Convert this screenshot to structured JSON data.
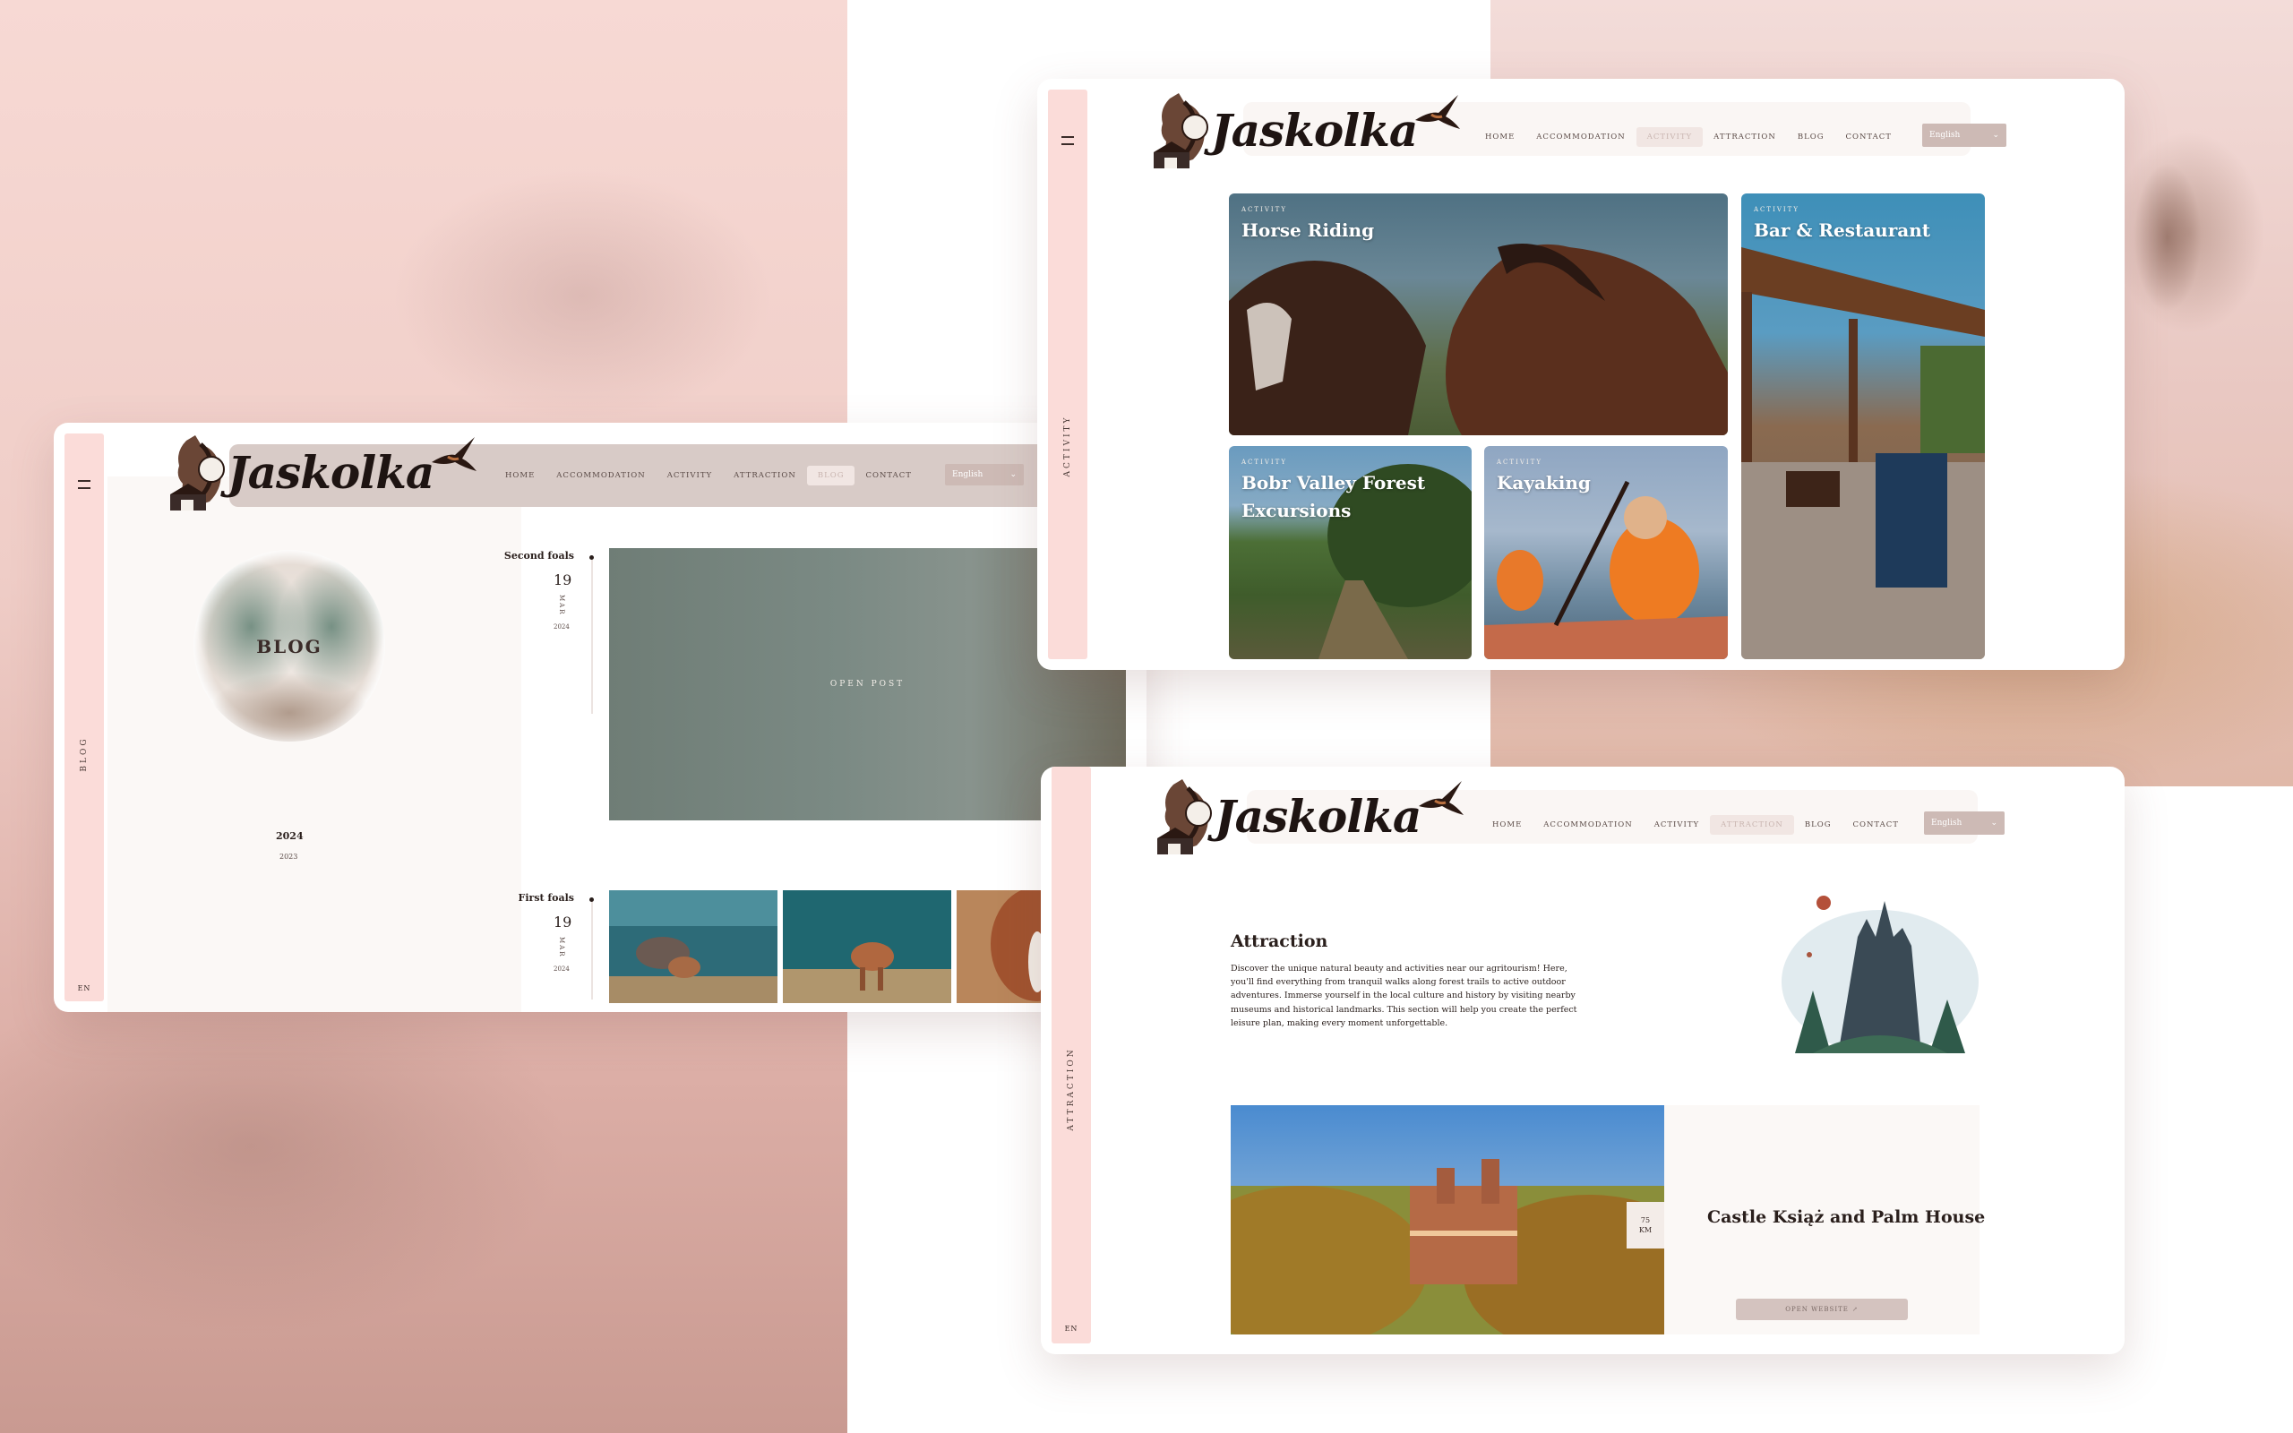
{
  "brand": {
    "logo_text": "Jaskolka"
  },
  "nav": [
    "HOME",
    "ACCOMMODATION",
    "ACTIVITY",
    "ATTRACTION",
    "BLOG",
    "CONTACT"
  ],
  "language": {
    "selected": "English",
    "short": "EN"
  },
  "blog_page": {
    "rail_label": "BLOG",
    "active_nav": "BLOG",
    "hero_title": "BLOG",
    "years": [
      "2024",
      "2023"
    ],
    "posts": [
      {
        "title": "Second foals",
        "day": "19",
        "month": "MAR",
        "year": "2024",
        "cta": "OPEN POST"
      },
      {
        "title": "First foals",
        "day": "19",
        "month": "MAR",
        "year": "2024"
      }
    ]
  },
  "activity_page": {
    "rail_label": "ACTIVITY",
    "active_nav": "ACTIVITY",
    "tiles": [
      {
        "tag": "ACTIVITY",
        "name": "Horse Riding"
      },
      {
        "tag": "ACTIVITY",
        "name": "Bar & Restaurant"
      },
      {
        "tag": "ACTIVITY",
        "name": "Bobr Valley Forest Excursions"
      },
      {
        "tag": "ACTIVITY",
        "name": "Kayaking"
      }
    ]
  },
  "attraction_page": {
    "rail_label": "ATTRACTION",
    "active_nav": "ATTRACTION",
    "title": "Attraction",
    "description": "Discover the unique natural beauty and activities near our agritourism! Here, you'll find everything from tranquil walks along forest trails to active outdoor adventures. Immerse yourself in the local culture and history by visiting nearby museums and historical landmarks. This section will help you create the perfect leisure plan, making every moment unforgettable.",
    "item": {
      "name": "Castle Książ and Palm House",
      "distance_value": "75",
      "distance_unit": "KM",
      "cta": "OPEN WEBSITE"
    }
  },
  "colors": {
    "accent_pink": "#fbdcd9",
    "header_tan": "#d8cbc7",
    "select": "#cdbab5"
  }
}
